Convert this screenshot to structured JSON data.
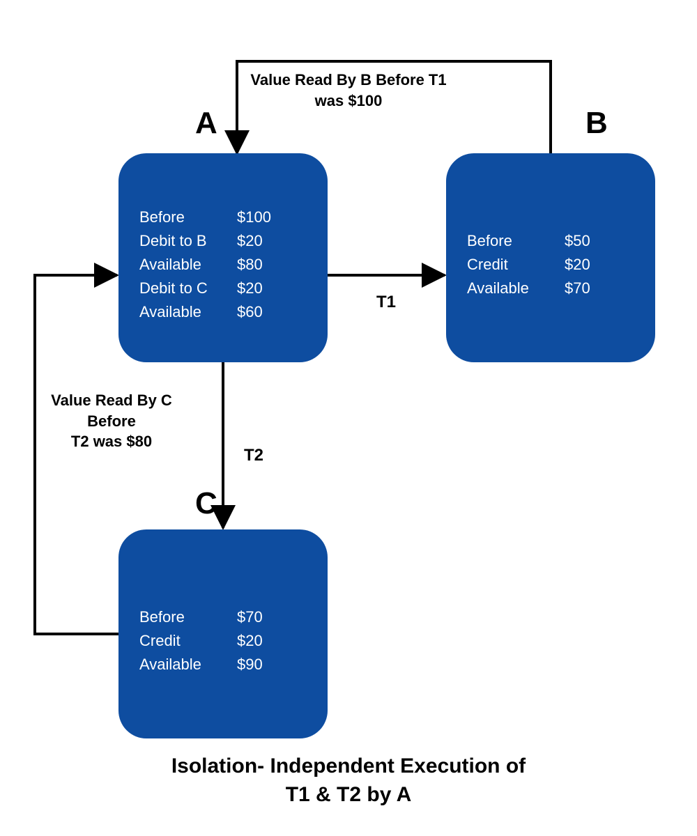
{
  "nodes": {
    "A": {
      "label": "A",
      "rows": [
        {
          "lab": "Before",
          "val": "$100"
        },
        {
          "lab": "Debit to B",
          "val": "$20"
        },
        {
          "lab": "Available",
          "val": "$80"
        },
        {
          "lab": "Debit to C",
          "val": "$20"
        },
        {
          "lab": "Available",
          "val": "$60"
        }
      ]
    },
    "B": {
      "label": "B",
      "rows": [
        {
          "lab": "Before",
          "val": "$50"
        },
        {
          "lab": "Credit",
          "val": "$20"
        },
        {
          "lab": "Available",
          "val": "$70"
        }
      ]
    },
    "C": {
      "label": "C",
      "rows": [
        {
          "lab": "Before",
          "val": "$70"
        },
        {
          "lab": "Credit",
          "val": "$20"
        },
        {
          "lab": "Available",
          "val": "$90"
        }
      ]
    }
  },
  "annotations": {
    "top": "Value Read By B Before T1 was $100",
    "left_line1": "Value Read By C",
    "left_line2": "Before",
    "left_line3": "T2 was $80"
  },
  "edges": {
    "t1": "T1",
    "t2": "T2"
  },
  "caption_line1": "Isolation- Independent Execution of",
  "caption_line2": "T1 & T2 by A"
}
